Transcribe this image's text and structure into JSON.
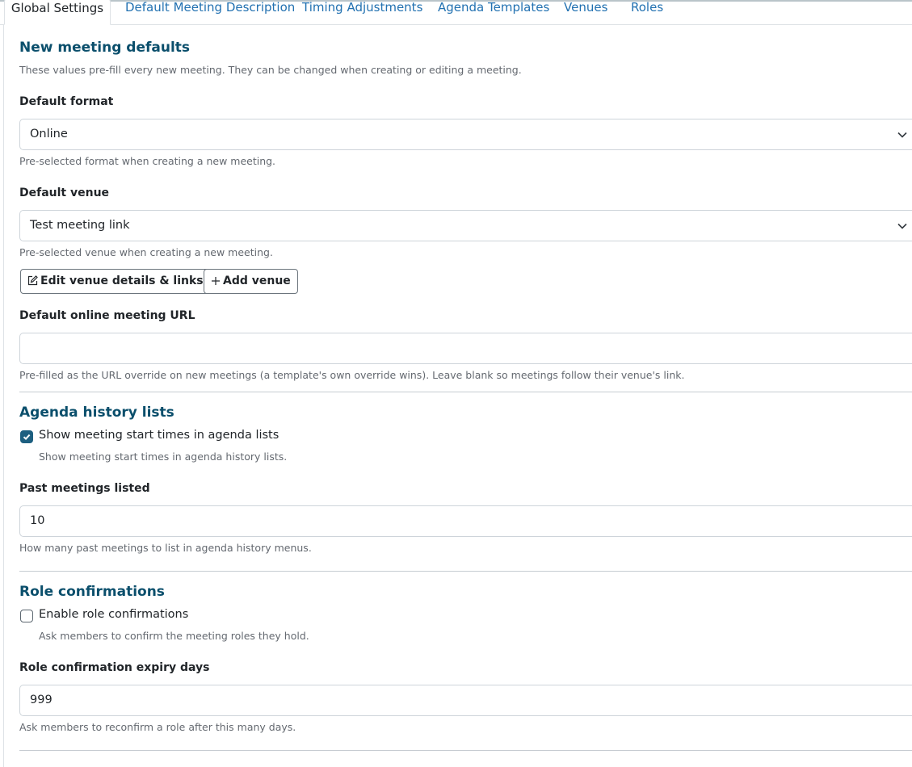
{
  "tabs": [
    {
      "label": "Global Settings",
      "active": true
    },
    {
      "label": "Default Meeting Description"
    },
    {
      "label": "Timing Adjustments"
    },
    {
      "label": "Agenda Templates"
    },
    {
      "label": "Venues"
    },
    {
      "label": "Roles"
    }
  ],
  "meeting_defaults": {
    "heading": "New meeting defaults",
    "intro": "These values pre-fill every new meeting. They can be changed when creating or editing a meeting.",
    "format": {
      "label": "Default format",
      "value": "Online",
      "help": "Pre-selected format when creating a new meeting."
    },
    "venue": {
      "label": "Default venue",
      "value": "Test meeting link",
      "help": "Pre-selected venue when creating a new meeting.",
      "edit_button": "Edit venue details & links",
      "add_button": "Add venue"
    },
    "online_url": {
      "label": "Default online meeting URL",
      "value": "",
      "help": "Pre-filled as the URL override on new meetings (a template's own override wins). Leave blank so meetings follow their venue's link."
    }
  },
  "agenda_history": {
    "heading": "Agenda history lists",
    "show_times": {
      "label": "Show meeting start times in agenda lists",
      "checked": true,
      "help": "Show meeting start times in agenda history lists."
    },
    "past_meetings": {
      "label": "Past meetings listed",
      "value": "10",
      "help": "How many past meetings to list in agenda history menus."
    }
  },
  "role_confirmations": {
    "heading": "Role confirmations",
    "enable": {
      "label": "Enable role confirmations",
      "checked": false,
      "help": "Ask members to confirm the meeting roles they hold."
    },
    "expiry": {
      "label": "Role confirmation expiry days",
      "value": "999",
      "help": "Ask members to reconfirm a role after this many days."
    }
  },
  "icons": {
    "select_arrow": "chevron-down-icon",
    "edit": "pencil-square-icon",
    "add": "plus-icon",
    "check": "check-icon"
  },
  "colors": {
    "link": "#2271b1",
    "heading": "#0b4f6c",
    "checkbox_checked": "#1d5f80"
  }
}
